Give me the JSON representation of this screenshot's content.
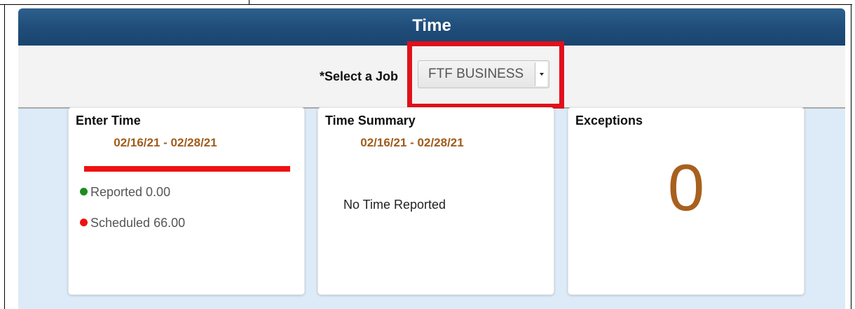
{
  "panel": {
    "title": "Time"
  },
  "job_selector": {
    "label": "*Select a Job",
    "selected_value": "FTF BUSINESS"
  },
  "tiles": [
    {
      "title": "Enter Time",
      "date_range": "02/16/21 - 02/28/21",
      "legend": [
        {
          "label": "Reported 0.00",
          "color": "#1e8c1e"
        },
        {
          "label": "Scheduled 66.00",
          "color": "#ee1111"
        }
      ],
      "progress": 0.0,
      "progress_color": "#ee1111"
    },
    {
      "title": "Time Summary",
      "date_range": "02/16/21 - 02/28/21",
      "message": "No Time Reported"
    },
    {
      "title": "Exceptions",
      "count": "0"
    }
  ],
  "colors": {
    "title_bar": "#1f4c78",
    "highlight": "#e0111b",
    "date_text": "#a05c1c",
    "count_text": "#a8601e"
  }
}
